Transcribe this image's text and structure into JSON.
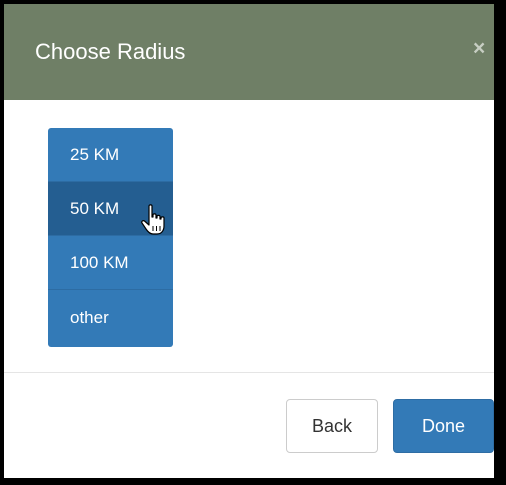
{
  "dialog": {
    "title": "Choose Radius",
    "close_symbol": "×",
    "close_icon": "close-icon"
  },
  "radius_options": [
    {
      "label": "25 KM"
    },
    {
      "label": "50 KM",
      "hovered": true
    },
    {
      "label": "100 KM"
    },
    {
      "label": "other"
    }
  ],
  "cursor_icon": "hand-pointer-icon",
  "footer": {
    "back_label": "Back",
    "done_label": "Done"
  },
  "colors": {
    "header_bg": "#6f7f66",
    "accent": "#337ab7",
    "hover": "#245e91"
  }
}
